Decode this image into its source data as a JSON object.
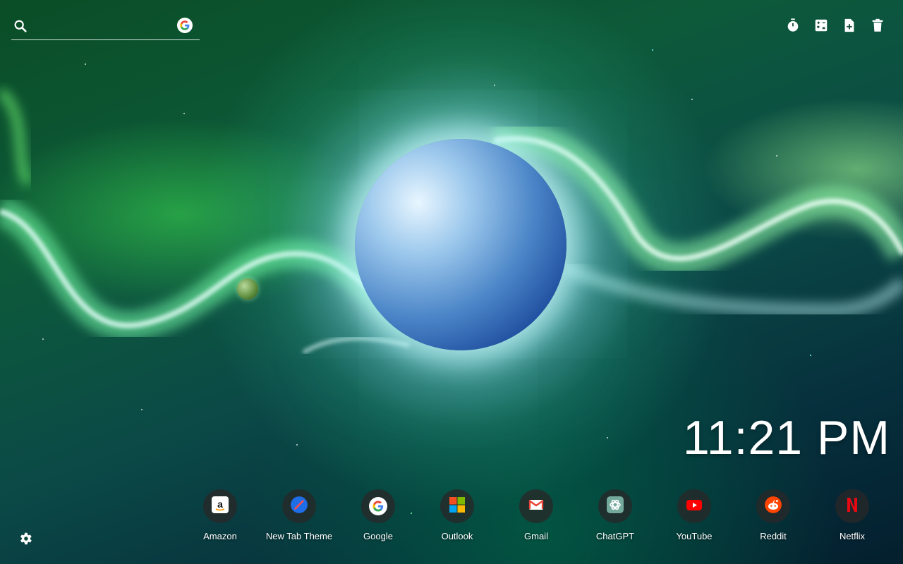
{
  "search": {
    "placeholder": "",
    "engine_icon": "google-icon"
  },
  "toolbar": {
    "icons": [
      "timer-icon",
      "calculator-icon",
      "add-note-icon",
      "trash-icon"
    ]
  },
  "clock": {
    "time": "11:21 PM"
  },
  "shortcuts": [
    {
      "label": "Amazon",
      "icon": "amazon-icon"
    },
    {
      "label": "New Tab Theme",
      "icon": "new-tab-theme-icon"
    },
    {
      "label": "Google",
      "icon": "google-icon"
    },
    {
      "label": "Outlook",
      "icon": "microsoft-icon"
    },
    {
      "label": "Gmail",
      "icon": "gmail-icon"
    },
    {
      "label": "ChatGPT",
      "icon": "chatgpt-icon"
    },
    {
      "label": "YouTube",
      "icon": "youtube-icon"
    },
    {
      "label": "Reddit",
      "icon": "reddit-icon"
    },
    {
      "label": "Netflix",
      "icon": "netflix-icon"
    }
  ],
  "settings": {
    "icon": "gear-icon"
  },
  "colors": {
    "text": "#ffffff",
    "shortcut_bg": "#282828"
  }
}
